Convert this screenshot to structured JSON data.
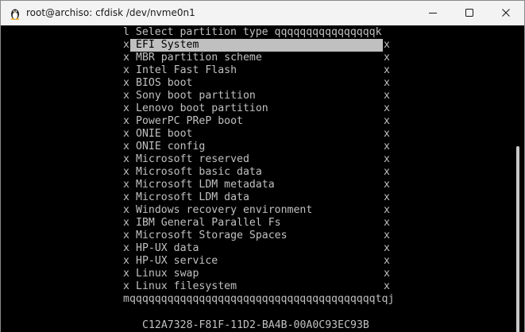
{
  "window": {
    "title": "root@archiso: cfdisk /dev/nvme0n1"
  },
  "dialog": {
    "header": "l Select partition type qqqqqqqqqqqqqqqqk",
    "footer": "mqqqqqqqqqqqqqqqqqqqqqqqqqqqqqqqqqqqqqqqtqj",
    "left_border": "x",
    "right_border": "x",
    "selected_index": 0,
    "items": [
      "EFI System",
      "MBR partition scheme",
      "Intel Fast Flash",
      "BIOS boot",
      "Sony boot partition",
      "Lenovo boot partition",
      "PowerPC PReP boot",
      "ONIE boot",
      "ONIE config",
      "Microsoft reserved",
      "Microsoft basic data",
      "Microsoft LDM metadata",
      "Microsoft LDM data",
      "Windows recovery environment",
      "IBM General Parallel Fs",
      "Microsoft Storage Spaces",
      "HP-UX data",
      "HP-UX service",
      "Linux swap",
      "Linux filesystem"
    ]
  },
  "status": {
    "type_guid": "C12A7328-F81F-11D2-BA4B-00A0C93EC93B"
  },
  "icons": {
    "app": "linux-penguin-icon",
    "minimize": "minimize-icon",
    "maximize": "maximize-icon",
    "close": "close-icon"
  }
}
